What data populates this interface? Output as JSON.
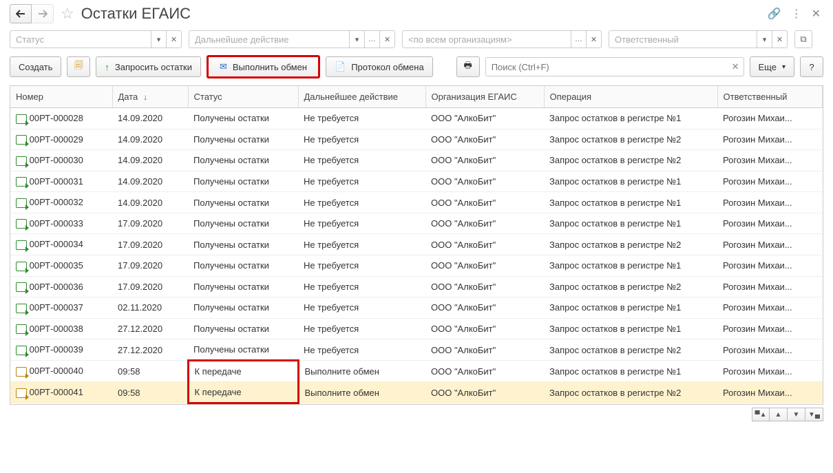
{
  "header": {
    "title": "Остатки ЕГАИС"
  },
  "filters": {
    "status": {
      "placeholder": "Статус"
    },
    "action": {
      "placeholder": "Дальнейшее действие"
    },
    "org": {
      "placeholder": "<по всем организациям>"
    },
    "resp": {
      "placeholder": "Ответственный"
    }
  },
  "toolbar": {
    "create": "Создать",
    "request": "Запросить остатки",
    "exchange": "Выполнить обмен",
    "protocol": "Протокол обмена",
    "search_placeholder": "Поиск (Ctrl+F)",
    "more": "Еще",
    "help": "?"
  },
  "columns": {
    "num": "Номер",
    "date": "Дата",
    "status": "Статус",
    "action": "Дальнейшее действие",
    "org": "Организация ЕГАИС",
    "op": "Операция",
    "resp": "Ответственный"
  },
  "rows": [
    {
      "num": "00РТ-000028",
      "date": "14.09.2020",
      "status": "Получены остатки",
      "action": "Не требуется",
      "org": "ООО \"АлкоБит\"",
      "op": "Запрос остатков в регистре №1",
      "resp": "Рогозин Михаи...",
      "pending": false,
      "sel": false,
      "hl": false
    },
    {
      "num": "00РТ-000029",
      "date": "14.09.2020",
      "status": "Получены остатки",
      "action": "Не требуется",
      "org": "ООО \"АлкоБит\"",
      "op": "Запрос остатков в регистре №2",
      "resp": "Рогозин Михаи...",
      "pending": false,
      "sel": false,
      "hl": false
    },
    {
      "num": "00РТ-000030",
      "date": "14.09.2020",
      "status": "Получены остатки",
      "action": "Не требуется",
      "org": "ООО \"АлкоБит\"",
      "op": "Запрос остатков в регистре №2",
      "resp": "Рогозин Михаи...",
      "pending": false,
      "sel": false,
      "hl": false
    },
    {
      "num": "00РТ-000031",
      "date": "14.09.2020",
      "status": "Получены остатки",
      "action": "Не требуется",
      "org": "ООО \"АлкоБит\"",
      "op": "Запрос остатков в регистре №1",
      "resp": "Рогозин Михаи...",
      "pending": false,
      "sel": false,
      "hl": false
    },
    {
      "num": "00РТ-000032",
      "date": "14.09.2020",
      "status": "Получены остатки",
      "action": "Не требуется",
      "org": "ООО \"АлкоБит\"",
      "op": "Запрос остатков в регистре №1",
      "resp": "Рогозин Михаи...",
      "pending": false,
      "sel": false,
      "hl": false
    },
    {
      "num": "00РТ-000033",
      "date": "17.09.2020",
      "status": "Получены остатки",
      "action": "Не требуется",
      "org": "ООО \"АлкоБит\"",
      "op": "Запрос остатков в регистре №1",
      "resp": "Рогозин Михаи...",
      "pending": false,
      "sel": false,
      "hl": false
    },
    {
      "num": "00РТ-000034",
      "date": "17.09.2020",
      "status": "Получены остатки",
      "action": "Не требуется",
      "org": "ООО \"АлкоБит\"",
      "op": "Запрос остатков в регистре №2",
      "resp": "Рогозин Михаи...",
      "pending": false,
      "sel": false,
      "hl": false
    },
    {
      "num": "00РТ-000035",
      "date": "17.09.2020",
      "status": "Получены остатки",
      "action": "Не требуется",
      "org": "ООО \"АлкоБит\"",
      "op": "Запрос остатков в регистре №1",
      "resp": "Рогозин Михаи...",
      "pending": false,
      "sel": false,
      "hl": false
    },
    {
      "num": "00РТ-000036",
      "date": "17.09.2020",
      "status": "Получены остатки",
      "action": "Не требуется",
      "org": "ООО \"АлкоБит\"",
      "op": "Запрос остатков в регистре №2",
      "resp": "Рогозин Михаи...",
      "pending": false,
      "sel": false,
      "hl": false
    },
    {
      "num": "00РТ-000037",
      "date": "02.11.2020",
      "status": "Получены остатки",
      "action": "Не требуется",
      "org": "ООО \"АлкоБит\"",
      "op": "Запрос остатков в регистре №1",
      "resp": "Рогозин Михаи...",
      "pending": false,
      "sel": false,
      "hl": false
    },
    {
      "num": "00РТ-000038",
      "date": "27.12.2020",
      "status": "Получены остатки",
      "action": "Не требуется",
      "org": "ООО \"АлкоБит\"",
      "op": "Запрос остатков в регистре №1",
      "resp": "Рогозин Михаи...",
      "pending": false,
      "sel": false,
      "hl": false
    },
    {
      "num": "00РТ-000039",
      "date": "27.12.2020",
      "status": "Получены остатки",
      "action": "Не требуется",
      "org": "ООО \"АлкоБит\"",
      "op": "Запрос остатков в регистре №2",
      "resp": "Рогозин Михаи...",
      "pending": false,
      "sel": false,
      "hl": false
    },
    {
      "num": "00РТ-000040",
      "date": "09:58",
      "status": "К передаче",
      "action": "Выполните обмен",
      "org": "ООО \"АлкоБит\"",
      "op": "Запрос остатков в регистре №1",
      "resp": "Рогозин Михаи...",
      "pending": true,
      "sel": false,
      "hl": true
    },
    {
      "num": "00РТ-000041",
      "date": "09:58",
      "status": "К передаче",
      "action": "Выполните обмен",
      "org": "ООО \"АлкоБит\"",
      "op": "Запрос остатков в регистре №2",
      "resp": "Рогозин Михаи...",
      "pending": true,
      "sel": true,
      "hl": true
    }
  ]
}
